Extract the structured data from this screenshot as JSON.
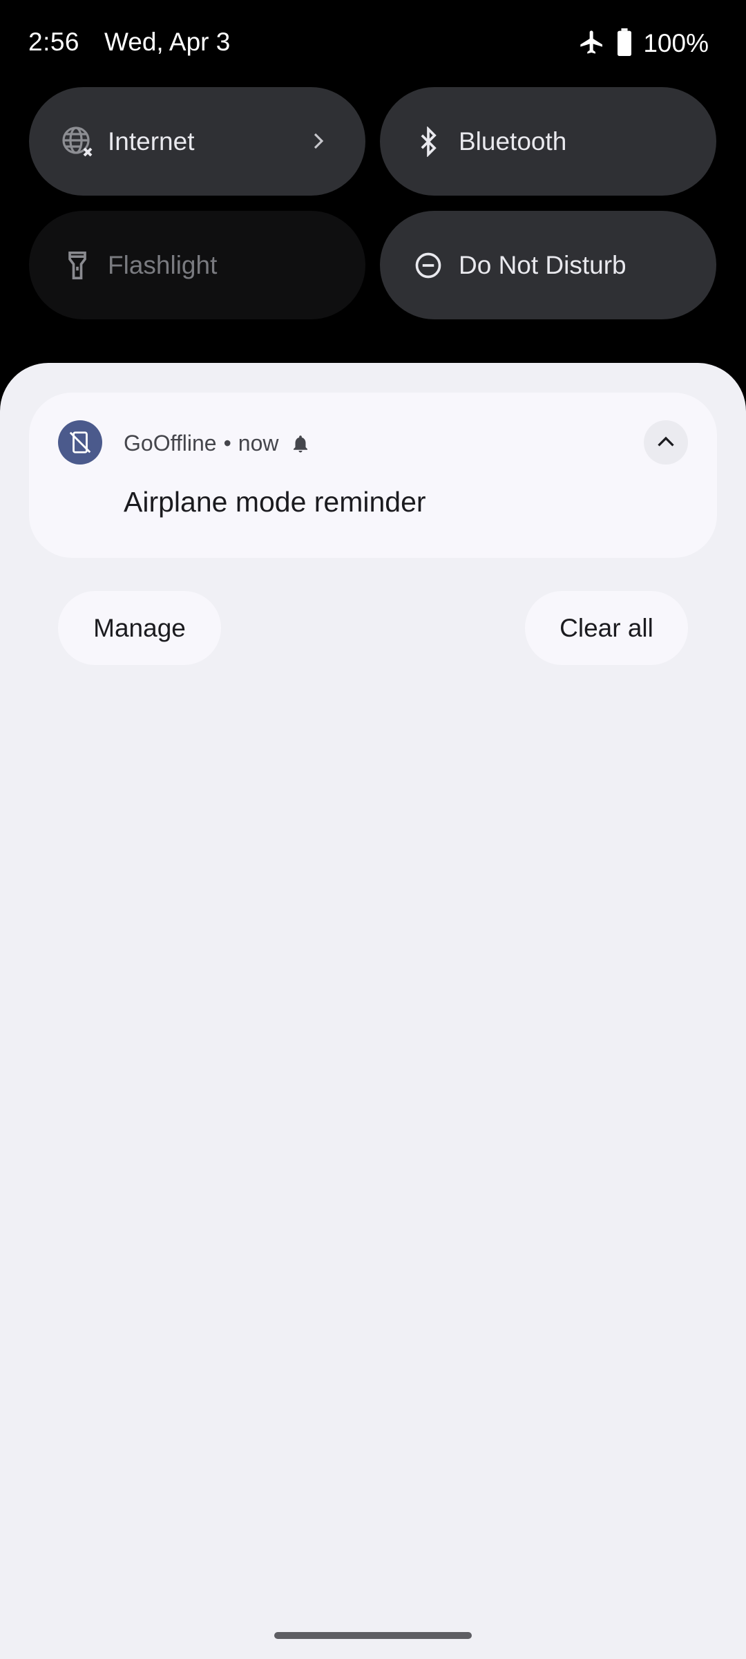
{
  "status_bar": {
    "time": "2:56",
    "date": "Wed, Apr 3",
    "battery_text": "100%",
    "icons": [
      "airplane-icon",
      "battery-icon"
    ]
  },
  "quick_settings": {
    "tiles": [
      {
        "label": "Internet",
        "icon": "globe-off-icon",
        "state": "active",
        "has_chevron": true
      },
      {
        "label": "Bluetooth",
        "icon": "bluetooth-icon",
        "state": "active"
      },
      {
        "label": "Flashlight",
        "icon": "flashlight-icon",
        "state": "inactive"
      },
      {
        "label": "Do Not Disturb",
        "icon": "do-not-disturb-icon",
        "state": "active"
      }
    ]
  },
  "notification": {
    "app_name": "GoOffline",
    "separator": "•",
    "time": "now",
    "title": "Airplane mode reminder",
    "app_icon": "phone-off-icon",
    "alert_icon": "bell-icon",
    "collapse_icon": "chevron-up-icon"
  },
  "actions": {
    "manage_label": "Manage",
    "clear_all_label": "Clear all"
  },
  "colors": {
    "shade_bg": "#f0f0f5",
    "card_bg": "#f8f7fc",
    "tile_active": "#2f3034",
    "tile_inactive": "#0f0f10",
    "app_icon_bg": "#4b5a8c"
  }
}
